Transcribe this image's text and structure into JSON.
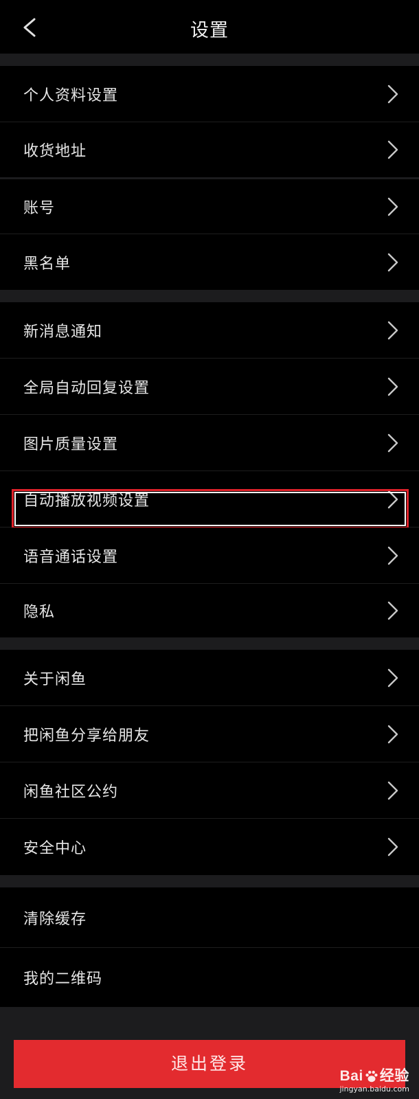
{
  "header": {
    "title": "设置",
    "back_icon": "chevron-left-icon"
  },
  "groups": [
    {
      "items": [
        {
          "label": "个人资料设置",
          "icon": "chevron-right-icon"
        },
        {
          "label": "收货地址",
          "icon": "chevron-right-icon"
        }
      ]
    },
    {
      "items": [
        {
          "label": "账号",
          "icon": "chevron-right-icon"
        },
        {
          "label": "黑名单",
          "icon": "chevron-right-icon"
        }
      ]
    },
    {
      "items": [
        {
          "label": "新消息通知",
          "icon": "chevron-right-icon"
        },
        {
          "label": "全局自动回复设置",
          "icon": "chevron-right-icon"
        },
        {
          "label": "图片质量设置",
          "icon": "chevron-right-icon"
        },
        {
          "label": "自动播放视频设置",
          "icon": "chevron-right-icon",
          "highlighted": true
        },
        {
          "label": "语音通话设置",
          "icon": "chevron-right-icon"
        },
        {
          "label": "隐私",
          "icon": "chevron-right-icon"
        }
      ]
    },
    {
      "items": [
        {
          "label": "关于闲鱼",
          "icon": "chevron-right-icon"
        },
        {
          "label": "把闲鱼分享给朋友",
          "icon": "chevron-right-icon"
        },
        {
          "label": "闲鱼社区公约",
          "icon": "chevron-right-icon"
        },
        {
          "label": "安全中心",
          "icon": "chevron-right-icon"
        }
      ]
    },
    {
      "items": [
        {
          "label": "清除缓存"
        },
        {
          "label": "我的二维码"
        }
      ]
    }
  ],
  "logout": {
    "label": "退出登录"
  },
  "watermark": {
    "logo_left": "Bai",
    "logo_right": "经验",
    "url": "jingyan.baidu.com"
  },
  "colors": {
    "background": "#000000",
    "separator": "#1c1c1e",
    "highlight_border": "#e1222a",
    "logout_button": "#e32b2f"
  }
}
